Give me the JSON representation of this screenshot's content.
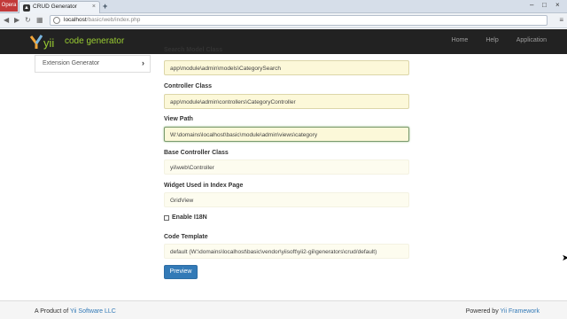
{
  "browser": {
    "menu_label": "Opera",
    "tab_title": "CRUD Generator",
    "new_tab": "+",
    "url_host": "localhost",
    "url_path": "/basic/web/index.php"
  },
  "app": {
    "brand": "code generator",
    "logo_text": "yii",
    "nav": [
      "Home",
      "Help",
      "Application"
    ],
    "accent_color": "#9acd32"
  },
  "sidebar": {
    "items": [
      {
        "label": "Extension Generator",
        "icon": "chevron-right-icon"
      }
    ]
  },
  "form": {
    "search_model_label": "Search Model Class",
    "search_model_value": "app\\module\\admin\\models\\CategorySearch",
    "controller_label": "Controller Class",
    "controller_value": "app\\module\\admin\\controllers\\CategoryController",
    "view_path_label": "View Path",
    "view_path_value": "W:\\domains\\localhost\\basic\\module\\admin\\views\\category",
    "base_controller_label": "Base Controller Class",
    "base_controller_value": "yii\\web\\Controller",
    "widget_label": "Widget Used in Index Page",
    "widget_value": "GridView",
    "i18n_label": "Enable I18N",
    "code_template_label": "Code Template",
    "code_template_value": "default (W:\\domains\\localhost\\basic\\vendor\\yiisoft\\yii2-gii\\generators\\crud/default)",
    "preview_button": "Preview"
  },
  "footer": {
    "left_prefix": "A Product of",
    "left_link": "Yii Software LLC",
    "right_prefix": "Powered by",
    "right_link": "Yii Framework"
  }
}
